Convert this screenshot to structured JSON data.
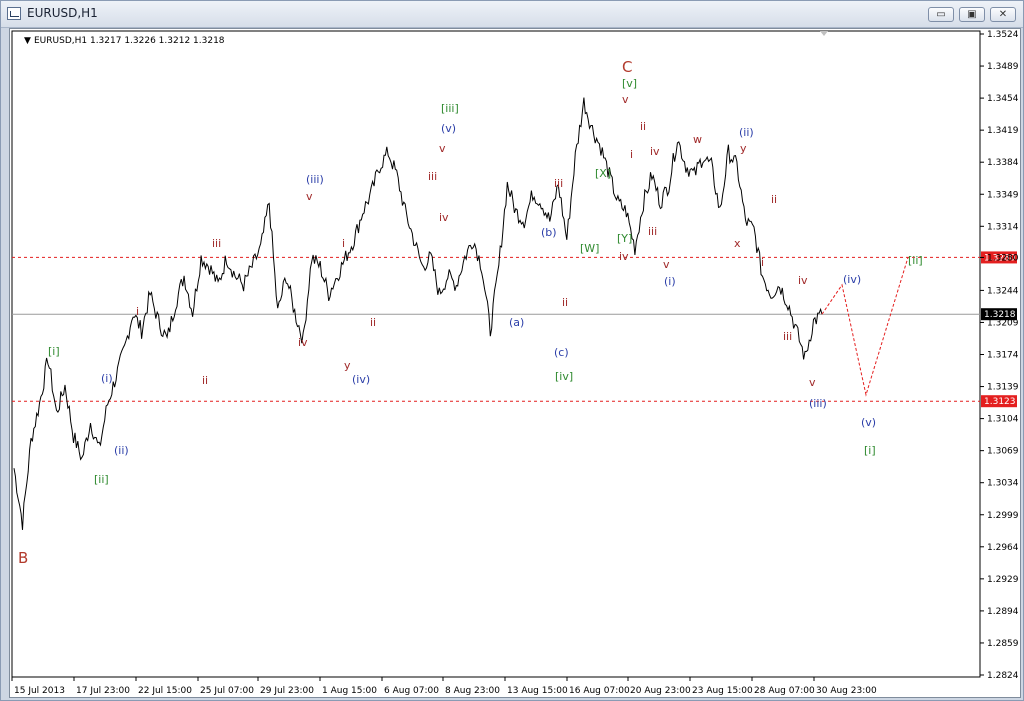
{
  "window": {
    "title": "EURUSD,H1",
    "buttons": {
      "minimize": "▭",
      "restore": "▣",
      "close": "✕"
    }
  },
  "chart_header": {
    "arrow": "▼",
    "text": "EURUSD,H1  1.3217 1.3226 1.3212 1.3218"
  },
  "chart_data": {
    "type": "line",
    "symbol": "EURUSD",
    "timeframe": "H1",
    "ohlc": {
      "open": 1.3217,
      "high": 1.3226,
      "low": 1.3212,
      "close": 1.3218
    },
    "ylim": [
      1.2824,
      1.3524
    ],
    "y_ticks": [
      "1.3524",
      "1.3489",
      "1.3454",
      "1.3419",
      "1.3384",
      "1.3349",
      "1.3314",
      "1.3280",
      "1.3244",
      "1.3209",
      "1.3174",
      "1.3139",
      "1.3104",
      "1.3069",
      "1.3034",
      "1.2999",
      "1.2964",
      "1.2929",
      "1.2894",
      "1.2859",
      "1.2824"
    ],
    "x_ticks": [
      "15 Jul 2013",
      "17 Jul 23:00",
      "22 Jul 15:00",
      "25 Jul 07:00",
      "29 Jul 23:00",
      "1 Aug 15:00",
      "6 Aug 07:00",
      "8 Aug 23:00",
      "13 Aug 15:00",
      "16 Aug 07:00",
      "20 Aug 23:00",
      "23 Aug 15:00",
      "28 Aug 07:00",
      "30 Aug 23:00"
    ],
    "series": [
      {
        "values": [
          1.305,
          1.299,
          1.308,
          1.312,
          1.317,
          1.311,
          1.314,
          1.3085,
          1.306,
          1.31,
          1.307,
          1.312,
          1.315,
          1.318,
          1.322,
          1.32,
          1.324,
          1.321,
          1.319,
          1.323,
          1.326,
          1.322,
          1.328,
          1.327,
          1.325,
          1.328,
          1.326,
          1.325,
          1.327,
          1.329,
          1.334,
          1.322,
          1.326,
          1.322,
          1.319,
          1.328,
          1.327,
          1.324,
          1.326,
          1.328,
          1.33,
          1.333,
          1.335,
          1.338,
          1.3395,
          1.337,
          1.333,
          1.33,
          1.327,
          1.328,
          1.324,
          1.326,
          1.325,
          1.328,
          1.33,
          1.327,
          1.32,
          1.327,
          1.336,
          1.333,
          1.332,
          1.335,
          1.334,
          1.332,
          1.336,
          1.33,
          1.339,
          1.345,
          1.342,
          1.34,
          1.337,
          1.334,
          1.333,
          1.329,
          1.334,
          1.337,
          1.334,
          1.336,
          1.341,
          1.338,
          1.337,
          1.339,
          1.338,
          1.333,
          1.3395,
          1.338,
          1.332,
          1.331,
          1.326,
          1.324,
          1.325,
          1.323,
          1.32,
          1.317,
          1.321,
          1.3218
        ]
      },
      {
        "name": "projection",
        "values": [
          1.3218,
          1.325,
          1.313,
          1.328
        ]
      }
    ],
    "levels": [
      {
        "label": "1.3280",
        "value": 1.328,
        "color": "#e41f1f",
        "style": "dashed"
      },
      {
        "label": "1.3218",
        "value": 1.3218,
        "color": "#9a9a9a",
        "style": "solid",
        "current": true
      },
      {
        "label": "1.3123",
        "value": 1.3123,
        "color": "#e41f1f",
        "style": "dashed"
      }
    ],
    "wave_labels": [
      {
        "text": "B",
        "color": "#b23a2c"
      },
      {
        "text": "[i]",
        "color": "#2f8a2f"
      },
      {
        "text": "[ii]",
        "color": "#2f8a2f"
      },
      {
        "text": "(i)",
        "color": "#2b3ea8"
      },
      {
        "text": "(ii)",
        "color": "#2b3ea8"
      },
      {
        "text": "i",
        "color": "#a02828"
      },
      {
        "text": "ii",
        "color": "#a02828"
      },
      {
        "text": "iii",
        "color": "#a02828"
      },
      {
        "text": "iv",
        "color": "#a02828"
      },
      {
        "text": "(iii)",
        "color": "#2b3ea8"
      },
      {
        "text": "v",
        "color": "#a02828"
      },
      {
        "text": "i",
        "color": "#a02828"
      },
      {
        "text": "ii",
        "color": "#a02828"
      },
      {
        "text": "y",
        "color": "#a02828"
      },
      {
        "text": "(iv)",
        "color": "#2b3ea8"
      },
      {
        "text": "[iii]",
        "color": "#2f8a2f"
      },
      {
        "text": "(v)",
        "color": "#2b3ea8"
      },
      {
        "text": "v",
        "color": "#a02828"
      },
      {
        "text": "iii",
        "color": "#a02828"
      },
      {
        "text": "iv",
        "color": "#a02828"
      },
      {
        "text": "(a)",
        "color": "#2b3ea8"
      },
      {
        "text": "(b)",
        "color": "#2b3ea8"
      },
      {
        "text": "(c)",
        "color": "#2b3ea8"
      },
      {
        "text": "[iv]",
        "color": "#2f8a2f"
      },
      {
        "text": "iii",
        "color": "#a02828"
      },
      {
        "text": "ii",
        "color": "#a02828"
      },
      {
        "text": "[W]",
        "color": "#2f8a2f"
      },
      {
        "text": "[X]",
        "color": "#2f8a2f"
      },
      {
        "text": "[Y]",
        "color": "#2f8a2f"
      },
      {
        "text": "iv",
        "color": "#a02828"
      },
      {
        "text": "C",
        "color": "#b23a2c"
      },
      {
        "text": "[v]",
        "color": "#2f8a2f"
      },
      {
        "text": "v",
        "color": "#a02828"
      },
      {
        "text": "ii",
        "color": "#a02828"
      },
      {
        "text": "i",
        "color": "#a02828"
      },
      {
        "text": "iv",
        "color": "#a02828"
      },
      {
        "text": "iii",
        "color": "#a02828"
      },
      {
        "text": "v",
        "color": "#a02828"
      },
      {
        "text": "(i)",
        "color": "#2b3ea8"
      },
      {
        "text": "w",
        "color": "#a02828"
      },
      {
        "text": "(ii)",
        "color": "#2b3ea8"
      },
      {
        "text": "y",
        "color": "#a02828"
      },
      {
        "text": "x",
        "color": "#a02828"
      },
      {
        "text": "ii",
        "color": "#a02828"
      },
      {
        "text": "i",
        "color": "#a02828"
      },
      {
        "text": "iv",
        "color": "#a02828"
      },
      {
        "text": "iii",
        "color": "#a02828"
      },
      {
        "text": "v",
        "color": "#a02828"
      },
      {
        "text": "(iii)",
        "color": "#2b3ea8"
      },
      {
        "text": "(iv)",
        "color": "#2b3ea8"
      },
      {
        "text": "(v)",
        "color": "#2b3ea8"
      },
      {
        "text": "[i]",
        "color": "#2f8a2f"
      },
      {
        "text": "[ii]",
        "color": "#2f8a2f"
      }
    ]
  }
}
